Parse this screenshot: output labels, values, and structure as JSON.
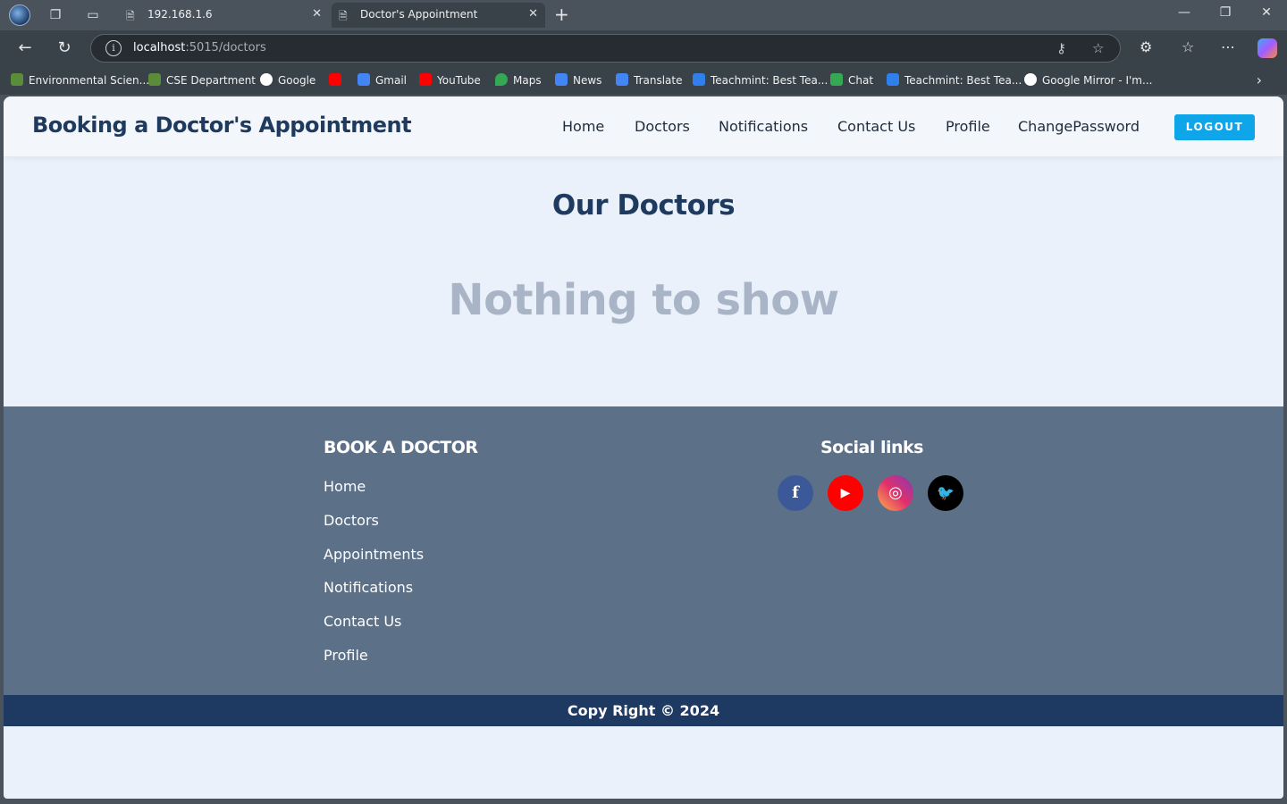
{
  "browser": {
    "tabs": [
      {
        "title": "192.168.1.6",
        "active": false
      },
      {
        "title": "Doctor's Appointment",
        "active": true
      }
    ],
    "address": {
      "host": "localhost",
      "path": ":5015/doctors"
    },
    "bookmarks": [
      {
        "label": "Environmental Scien...",
        "color": "#5b8c3a"
      },
      {
        "label": "CSE Department",
        "color": "#5b8c3a"
      },
      {
        "label": "Google",
        "color": "#ffffff"
      },
      {
        "label": "",
        "color": "#ff0000"
      },
      {
        "label": "Gmail",
        "color": "#4285f4"
      },
      {
        "label": "YouTube",
        "color": "#ff0000"
      },
      {
        "label": "Maps",
        "color": "#34a853"
      },
      {
        "label": "News",
        "color": "#4285f4"
      },
      {
        "label": "Translate",
        "color": "#4285f4"
      },
      {
        "label": "Teachmint: Best Tea...",
        "color": "#2f80ed"
      },
      {
        "label": "Chat",
        "color": "#34a853"
      },
      {
        "label": "Teachmint: Best Tea...",
        "color": "#2f80ed"
      },
      {
        "label": "Google Mirror - I'm...",
        "color": "#ffffff"
      }
    ]
  },
  "header": {
    "brand": "Booking a Doctor's Appointment",
    "nav": [
      "Home",
      "Doctors",
      "Notifications",
      "Contact Us",
      "Profile",
      "ChangePassword"
    ],
    "logout": "LOGOUT"
  },
  "main": {
    "title": "Our Doctors",
    "empty_message": "Nothing to show"
  },
  "footer": {
    "links_heading": "BOOK A DOCTOR",
    "links": [
      "Home",
      "Doctors",
      "Appointments",
      "Notifications",
      "Contact Us",
      "Profile"
    ],
    "social_heading": "Social links",
    "social": [
      {
        "name": "facebook-icon",
        "glyph": "f",
        "color": "#3b5998"
      },
      {
        "name": "youtube-icon",
        "glyph": "▶",
        "color": "#ff0000"
      },
      {
        "name": "instagram-icon",
        "glyph": "◎",
        "color": "#d6249f"
      },
      {
        "name": "twitter-icon",
        "glyph": "🐦",
        "color": "#000000"
      }
    ],
    "copyright": "Copy Right © 2024"
  }
}
